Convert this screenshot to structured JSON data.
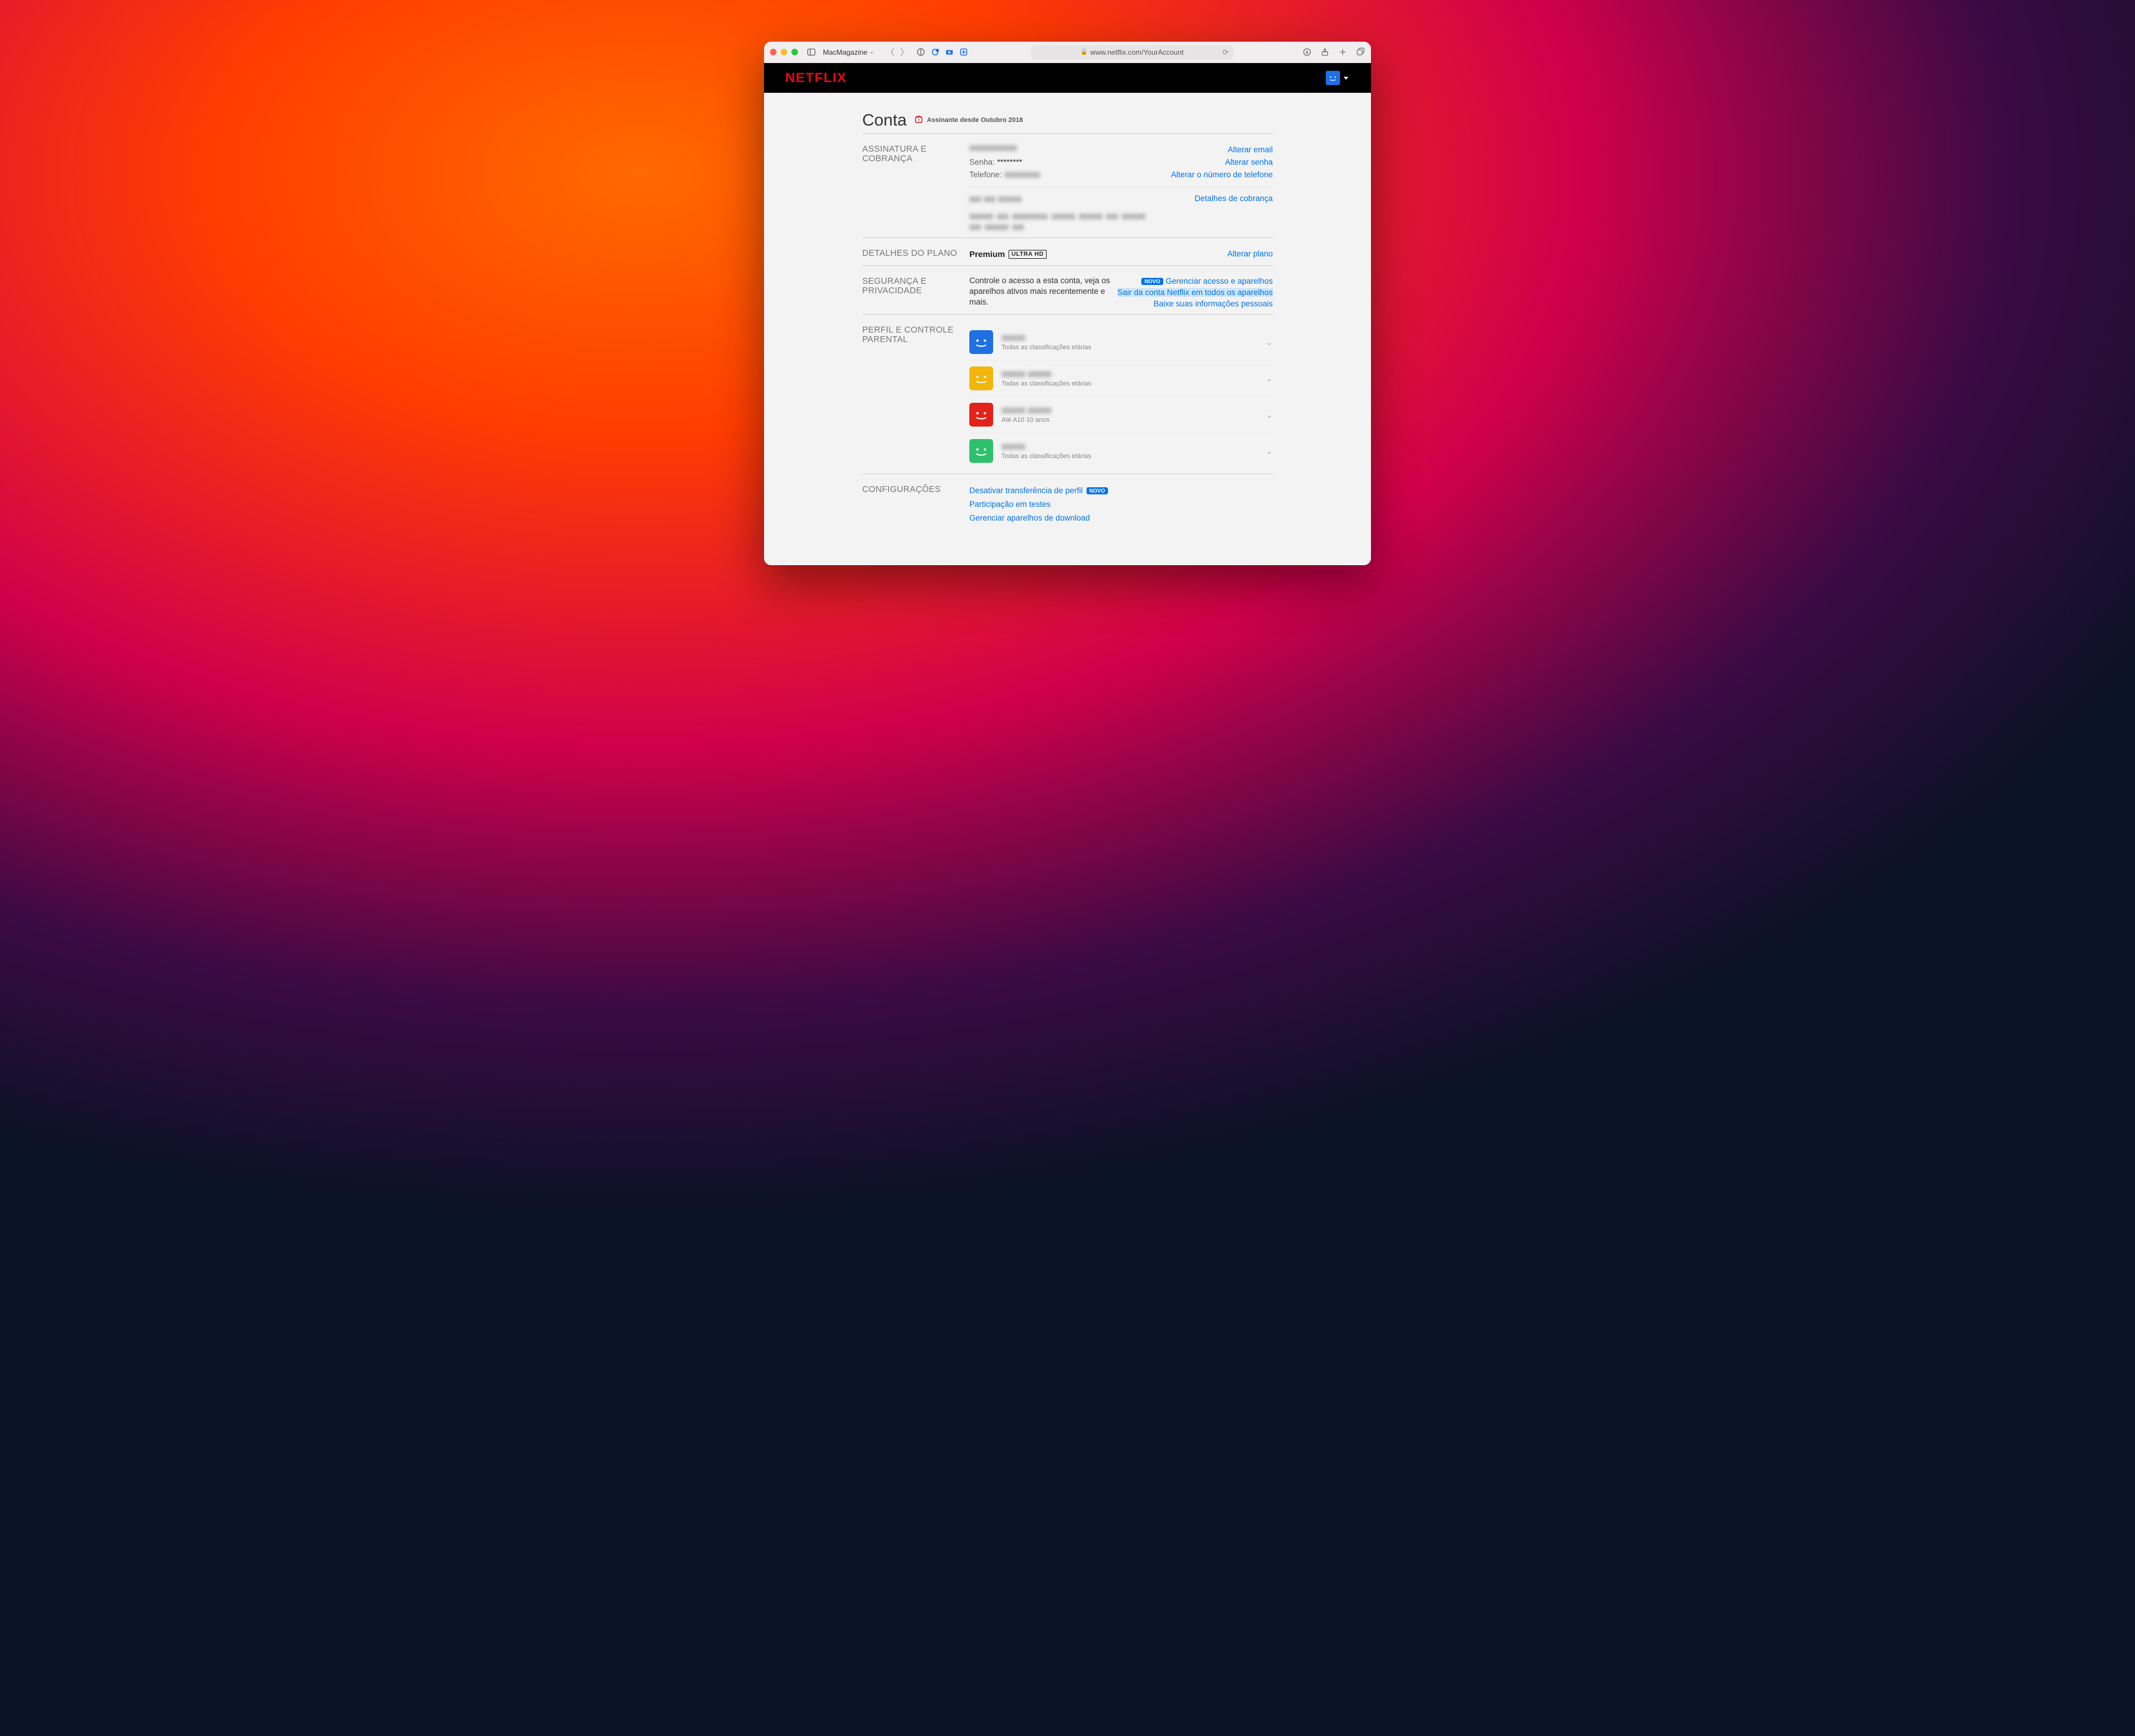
{
  "browser": {
    "tab_title": "MacMagazine",
    "url_display": "www.netflix.com/YourAccount"
  },
  "header": {
    "logo_text": "NETFLIX"
  },
  "page": {
    "title": "Conta",
    "member_since": "Assinante desde Outubro 2018"
  },
  "membership": {
    "section_label": "ASSINATURA E COBRANÇA",
    "password_label": "Senha:",
    "password_value": "********",
    "phone_label": "Telefone:",
    "links": {
      "change_email": "Alterar email",
      "change_password": "Alterar senha",
      "change_phone": "Alterar o número de telefone",
      "billing_details": "Detalhes de cobrança"
    }
  },
  "plan": {
    "section_label": "DETALHES DO PLANO",
    "plan_name": "Premium",
    "badge": "ULTRA HD",
    "change_plan": "Alterar plano"
  },
  "security": {
    "section_label": "SEGURANÇA E PRIVACIDADE",
    "description": "Controle o acesso a esta conta, veja os aparelhos ativos mais recentemente e mais.",
    "novo": "NOVO",
    "links": {
      "manage_access": "Gerenciar acesso e aparelhos",
      "sign_out_all": "Sair da conta Netflix em todos os aparelhos",
      "download_info": "Baixe suas informações pessoais"
    }
  },
  "profiles": {
    "section_label": "PERFIL E CONTROLE PARENTAL",
    "items": [
      {
        "color": "#1f6fe5",
        "name_blur": true,
        "rating": "Todas as classificações etárias"
      },
      {
        "color": "#f2b50c",
        "name_blur": true,
        "rating": "Todas as classificações etárias"
      },
      {
        "color": "#e2231a",
        "name_blur": true,
        "rating": "Até A10  10 anos"
      },
      {
        "color": "#2fc06b",
        "name_blur": true,
        "rating": "Todas as classificações etárias"
      }
    ]
  },
  "settings": {
    "section_label": "CONFIGURAÇÕES",
    "novo": "NOVO",
    "links": {
      "disable_transfer": "Desativar transferência de perfil",
      "test_participation": "Participação em testes",
      "manage_downloads": "Gerenciar aparelhos de download"
    }
  }
}
